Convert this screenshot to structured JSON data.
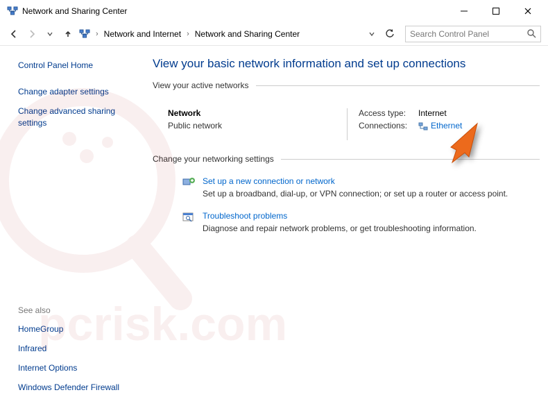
{
  "titlebar": {
    "title": "Network and Sharing Center"
  },
  "breadcrumb": {
    "parent": "Network and Internet",
    "current": "Network and Sharing Center"
  },
  "search": {
    "placeholder": "Search Control Panel"
  },
  "sidebar": {
    "home": "Control Panel Home",
    "items": [
      "Change adapter settings",
      "Change advanced sharing settings"
    ],
    "seealso_label": "See also",
    "seealso": [
      "HomeGroup",
      "Infrared",
      "Internet Options",
      "Windows Defender Firewall"
    ]
  },
  "main": {
    "heading": "View your basic network information and set up connections",
    "section1": "View your active networks",
    "net": {
      "name": "Network",
      "type": "Public network",
      "access_label": "Access type:",
      "access_value": "Internet",
      "conn_label": "Connections:",
      "conn_value": "Ethernet"
    },
    "section2": "Change your networking settings",
    "opt1": {
      "title": "Set up a new connection or network",
      "desc": "Set up a broadband, dial-up, or VPN connection; or set up a router or access point."
    },
    "opt2": {
      "title": "Troubleshoot problems",
      "desc": "Diagnose and repair network problems, or get troubleshooting information."
    }
  }
}
